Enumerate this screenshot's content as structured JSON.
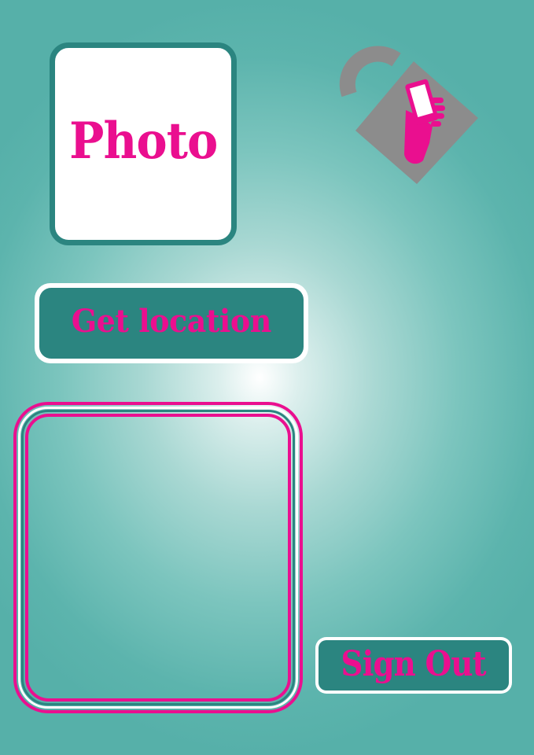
{
  "photo": {
    "label": "Photo"
  },
  "logo": {
    "icon": "padlock-phone-icon"
  },
  "location": {
    "button_label": "Get location"
  },
  "map": {
    "icon": "map-frame"
  },
  "auth": {
    "signout_label": "Sign Out"
  },
  "colors": {
    "accent": "#ea0f8f",
    "primary": "#2b8580",
    "background": "#56b0a9",
    "logo_gray": "#8c8c8c"
  }
}
